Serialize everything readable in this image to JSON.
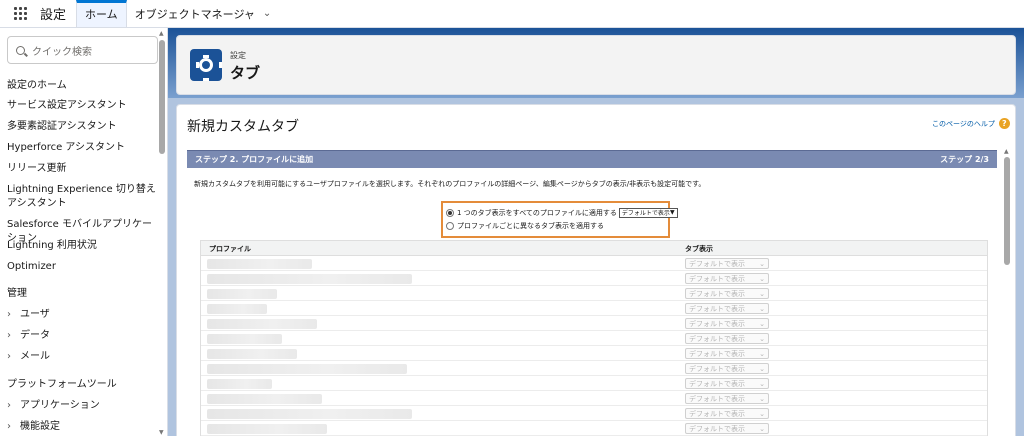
{
  "topbar": {
    "app_name": "設定",
    "tabs": [
      {
        "label": "ホーム",
        "active": true
      },
      {
        "label": "オブジェクトマネージャ",
        "active": false
      }
    ]
  },
  "sidebar": {
    "search_placeholder": "クイック検索",
    "items": [
      {
        "label": "設定のホーム"
      },
      {
        "label": "サービス設定アシスタント"
      },
      {
        "label": "多要素認証アシスタント"
      },
      {
        "label": "Hyperforce アシスタント"
      },
      {
        "label": "リリース更新"
      },
      {
        "label": "Lightning Experience 切り替えアシスタント"
      },
      {
        "label": "Salesforce モバイルアプリケーション"
      },
      {
        "label": "Lightning 利用状況"
      },
      {
        "label": "Optimizer"
      },
      {
        "label": "管理"
      },
      {
        "label": "ユーザ"
      },
      {
        "label": "データ"
      },
      {
        "label": "メール"
      },
      {
        "label": "プラットフォームツール"
      },
      {
        "label": "アプリケーション"
      },
      {
        "label": "機能設定"
      }
    ]
  },
  "header": {
    "breadcrumb": "設定",
    "title": "タブ",
    "icon": "gear-icon"
  },
  "content": {
    "title": "新規カスタムタブ",
    "help_link": "このページのヘルプ",
    "step_title": "ステップ 2. プロファイルに追加",
    "step_counter": "ステップ 2/3",
    "description": "新規カスタムタブを利用可能にするユーザプロファイルを選択します。それぞれのプロファイルの詳細ページ、編集ページからタブの表示/非表示も設定可能です。",
    "option_all": "1 つのタブ表示をすべてのプロファイルに適用する",
    "option_all_select": "デフォルトで表示",
    "option_each": "プロファイルごとに異なるタブ表示を適用する",
    "table": {
      "col_profile": "プロファイル",
      "col_tab": "タブ表示",
      "row_value": "デフォルトで表示"
    }
  },
  "colors": {
    "brand": "#1b5297",
    "accent": "#0176d3",
    "step_bar": "#7a8ab2",
    "highlight": "#e48c3a",
    "help": "#e9a324"
  }
}
